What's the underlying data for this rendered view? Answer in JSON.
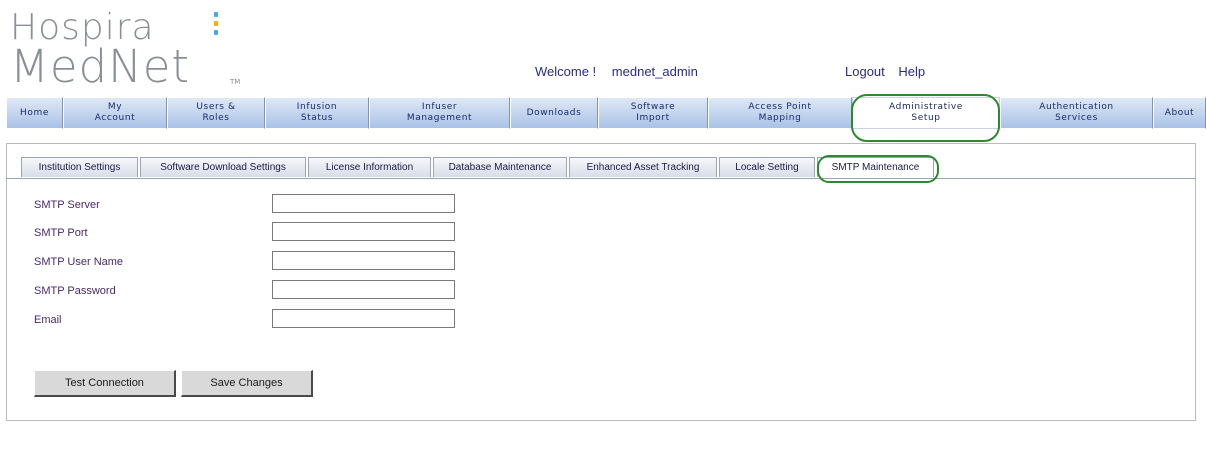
{
  "header": {
    "logo_line1": "Hospira",
    "logo_line2": "MedNet",
    "logo_tm": "TM",
    "welcome_label": "Welcome !",
    "username": "mednet_admin",
    "logout_label": "Logout",
    "help_label": "Help"
  },
  "main_nav": {
    "items": [
      {
        "label": "Home"
      },
      {
        "label": "My\nAccount"
      },
      {
        "label": "Users &\nRoles"
      },
      {
        "label": "Infusion\nStatus"
      },
      {
        "label": "Infuser\nManagement"
      },
      {
        "label": "Downloads"
      },
      {
        "label": "Software\nImport"
      },
      {
        "label": "Access Point\nMapping"
      },
      {
        "label": "Administrative\nSetup"
      },
      {
        "label": "Authentication\nServices"
      },
      {
        "label": "About"
      }
    ],
    "active": "Administrative Setup"
  },
  "sub_tabs": {
    "items": [
      {
        "label": "Institution Settings"
      },
      {
        "label": "Software Download Settings"
      },
      {
        "label": "License Information"
      },
      {
        "label": "Database Maintenance"
      },
      {
        "label": "Enhanced Asset Tracking"
      },
      {
        "label": "Locale Setting"
      },
      {
        "label": "SMTP Maintenance"
      }
    ],
    "active": "SMTP Maintenance"
  },
  "form": {
    "smtp_server_label": "SMTP Server",
    "smtp_server_value": "",
    "smtp_port_label": "SMTP Port",
    "smtp_port_value": "",
    "smtp_user_label": "SMTP User Name",
    "smtp_user_value": "",
    "smtp_password_label": "SMTP Password",
    "smtp_password_value": "",
    "email_label": "Email",
    "email_value": ""
  },
  "buttons": {
    "test_connection": "Test Connection",
    "save_changes": "Save Changes"
  },
  "colors": {
    "annotation_circle": "#2c8a2c",
    "nav_tab_gradient_top": "#dfe8f6",
    "nav_tab_gradient_bottom": "#a9c2e6",
    "label_text": "#4a2a6a"
  }
}
